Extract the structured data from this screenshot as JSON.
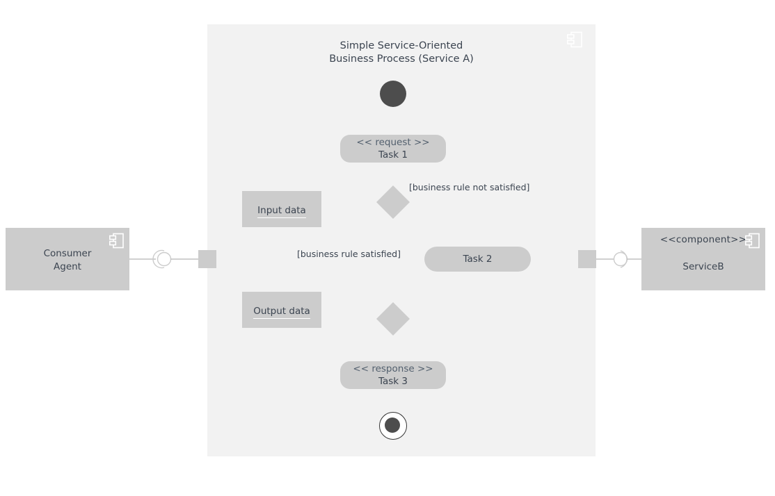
{
  "diagram": {
    "type": "uml-activity-component-diagram",
    "frame": {
      "title": "Simple Service-Oriented\nBusiness Process (Service A)",
      "icon": "component-icon",
      "background_color": "#f2f2f2"
    },
    "components": [
      {
        "id": "consumer",
        "stereotype": "",
        "name": "Consumer\nAgent",
        "icon": "component-icon",
        "fill_color": "#cccccc"
      },
      {
        "id": "serviceb",
        "stereotype": "<<component>>",
        "name": "ServiceB",
        "icon": "component-icon",
        "fill_color": "#cccccc"
      }
    ],
    "ports": [
      {
        "id": "port-left",
        "name": "left-port"
      },
      {
        "id": "port-right",
        "name": "right-port"
      }
    ],
    "connectors": [
      {
        "id": "assembly-left",
        "name": "ball-and-socket-connector"
      },
      {
        "id": "assembly-right",
        "name": "ball-and-socket-connector"
      }
    ],
    "nodes": {
      "initial": {
        "name": "initial-node",
        "fill_color": "#4d4d4d"
      },
      "final": {
        "name": "activity-final-node",
        "fill_color": "#4d4d4d"
      },
      "actions": [
        {
          "id": "task1",
          "stereotype": "<< request >>",
          "name": "Task 1"
        },
        {
          "id": "task2",
          "stereotype": "",
          "name": "Task 2"
        },
        {
          "id": "task3",
          "stereotype": "<< response >>",
          "name": "Task 3"
        }
      ],
      "objects": [
        {
          "id": "input",
          "name": "Input data"
        },
        {
          "id": "output",
          "name": "Output data"
        }
      ],
      "gateways": [
        {
          "id": "decision",
          "name": "decision-node"
        },
        {
          "id": "merge",
          "name": "merge-node"
        }
      ]
    },
    "guards": [
      {
        "id": "not-satisfied",
        "text": "[business rule not satisfied]"
      },
      {
        "id": "satisfied",
        "text": "[business rule satisfied]"
      }
    ],
    "colors": {
      "frame_background": "#f2f2f2",
      "shape_fill": "#cccccc",
      "node_dark": "#4d4d4d",
      "edge": "#b3b3b3",
      "text": "#3b4450",
      "page_background": "#ffffff"
    }
  }
}
